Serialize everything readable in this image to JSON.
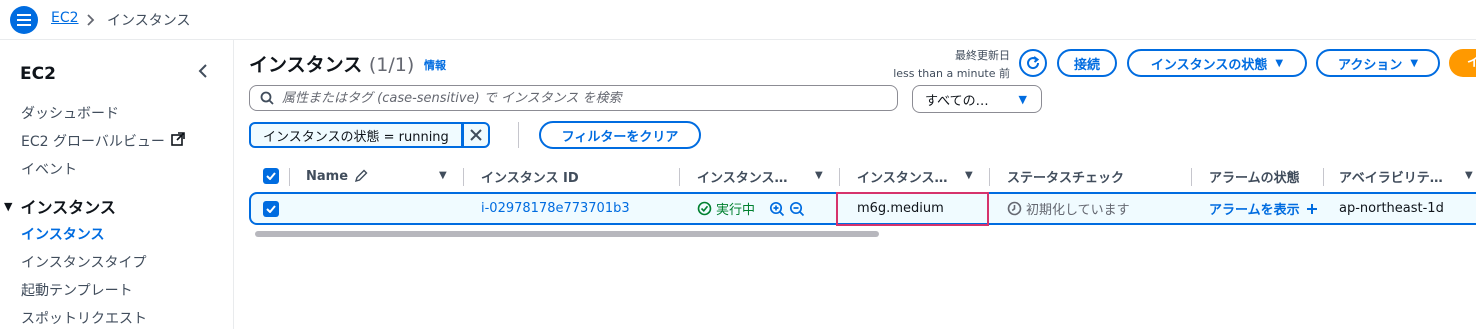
{
  "breadcrumb": {
    "root": "EC2",
    "current": "インスタンス"
  },
  "sidebar": {
    "title": "EC2",
    "items": [
      "ダッシュボード",
      "EC2 グローバルビュー",
      "イベント"
    ],
    "section": "インスタンス",
    "sub_items": [
      "インスタンス",
      "インスタンスタイプ",
      "起動テンプレート",
      "スポットリクエスト"
    ]
  },
  "header": {
    "title": "インスタンス",
    "count": "(1/1)",
    "info": "情報",
    "last_updated_label": "最終更新日",
    "last_updated_value": "less than a minute 前",
    "connect": "接続",
    "instance_state": "インスタンスの状態",
    "actions": "アクション",
    "launch": "イ"
  },
  "search": {
    "placeholder": "属性またはタグ (case-sensitive) で インスタンス を検索"
  },
  "select": {
    "value": "すべての…"
  },
  "filter": {
    "token": "インスタンスの状態 = running",
    "clear": "フィルターをクリア"
  },
  "table": {
    "columns": [
      "Name",
      "インスタンス ID",
      "インスタンス…",
      "インスタンス…",
      "ステータスチェック",
      "アラームの状態",
      "アベイラビリテ…"
    ],
    "row": {
      "name": "",
      "instance_id": "i-02978178e773701b3",
      "state": "実行中",
      "type": "m6g.medium",
      "status_check": "初期化しています",
      "alarm": "アラームを表示",
      "az": "ap-northeast-1d"
    }
  },
  "colors": {
    "accent": "#006ce0",
    "running": "#00802f",
    "highlight": "#d6336c",
    "orange": "#ff9900"
  }
}
